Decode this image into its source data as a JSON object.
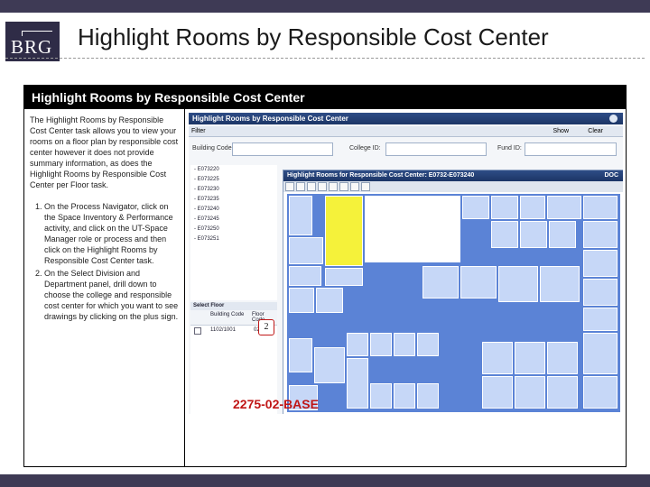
{
  "slide": {
    "title": "Highlight Rooms by Responsible Cost Center",
    "logo_text": "BRG"
  },
  "panel": {
    "heading": "Highlight Rooms by Responsible Cost Center",
    "intro": "The Highlight Rooms by Responsible Cost Center task allows you to view your rooms on a floor plan by responsible cost center however it does not provide summary information, as does the Highlight Rooms by Responsible Cost Center per Floor task.",
    "steps": [
      "On the Process Navigator, click on the Space Inventory & Performance activity, and click on the UT-Space Manager role or process and then click on the Highlight Rooms by Responsible Cost Center task.",
      "On the Select Division and Department panel, drill down to choose the college and responsible cost center for which you want to see drawings by clicking on the plus sign."
    ]
  },
  "app": {
    "title": "Highlight Rooms by Responsible Cost Center",
    "filter_label": "Filter",
    "show_label": "Show",
    "clear_label": "Clear",
    "building_label": "Building Code:",
    "college_label": "College ID:",
    "fund_label": "Fund ID:",
    "cost_centers": [
      "E073220",
      "E073225",
      "E073230",
      "E073235",
      "E073240",
      "E073245",
      "E073250",
      "E073251"
    ],
    "select_floor_label": "Select Floor",
    "col_building": "Building Code",
    "col_floor": "Floor Code",
    "floor_row": {
      "building": "1102/1001",
      "floor": "02"
    },
    "floorplan_title": "Highlight Rooms for Responsible Cost Center: E0732-E073240",
    "doc_label": "DOC",
    "drawing_name": "2275-02-BASE",
    "callout_number": "2"
  },
  "colors": {
    "title_bar": "#1c3566",
    "highlight": "#f5f23a",
    "room_fill": "#c6d7f7",
    "plan_background": "#5b83d6",
    "drawing_label": "#c01616"
  }
}
